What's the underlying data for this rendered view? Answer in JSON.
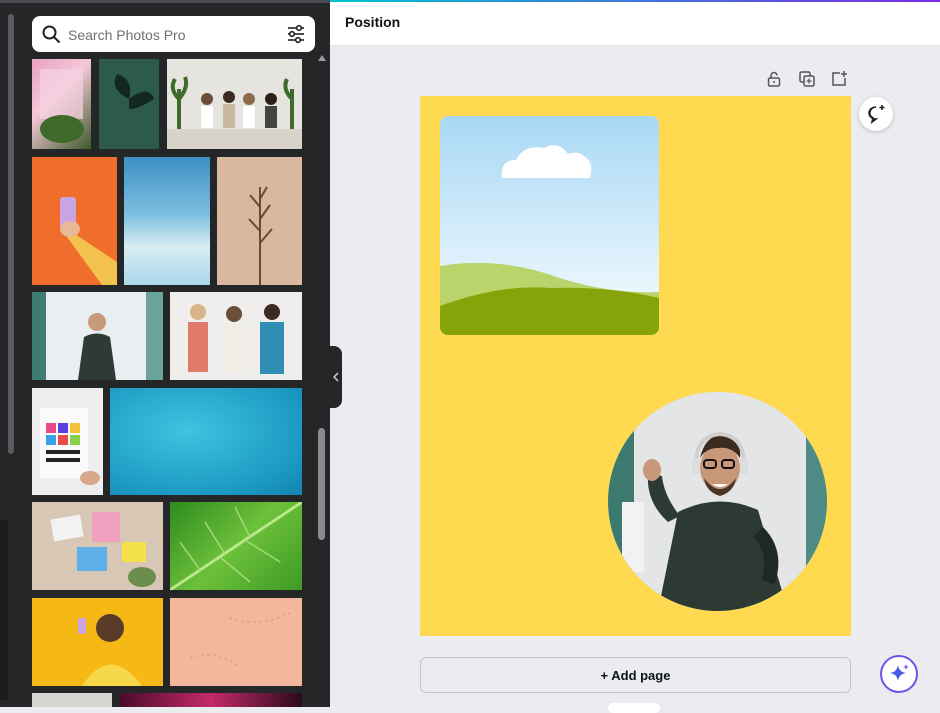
{
  "search": {
    "placeholder": "Search Photos Pro"
  },
  "header": {
    "position_label": "Position"
  },
  "canvas": {
    "add_page_label": "+ Add page",
    "page_color": "#ffd94f"
  },
  "colors": {
    "sidebar_bg": "#252627",
    "workspace_bg": "#ebecf0",
    "accent_purple": "#7d2ae8",
    "accent_teal": "#00c4cc"
  },
  "photos": [
    "pink shelf with plants",
    "plant shadow on green wall",
    "group of people seated among plants",
    "hand holding phone on orange",
    "blue ocean texture",
    "dried flower on beige",
    "smiling man sitting",
    "three women standing",
    "poster We Live To Create",
    "aerial turquoise ocean",
    "desk with papers",
    "green leaf closeup",
    "woman taking selfie on yellow",
    "sand texture peach",
    "dark image",
    "magenta image"
  ],
  "icons": [
    "search-icon",
    "filter-icon",
    "lock-icon",
    "duplicate-icon",
    "add-page-icon",
    "comment-add-icon",
    "magic-sparkle-icon",
    "collapse-chevron-icon"
  ]
}
